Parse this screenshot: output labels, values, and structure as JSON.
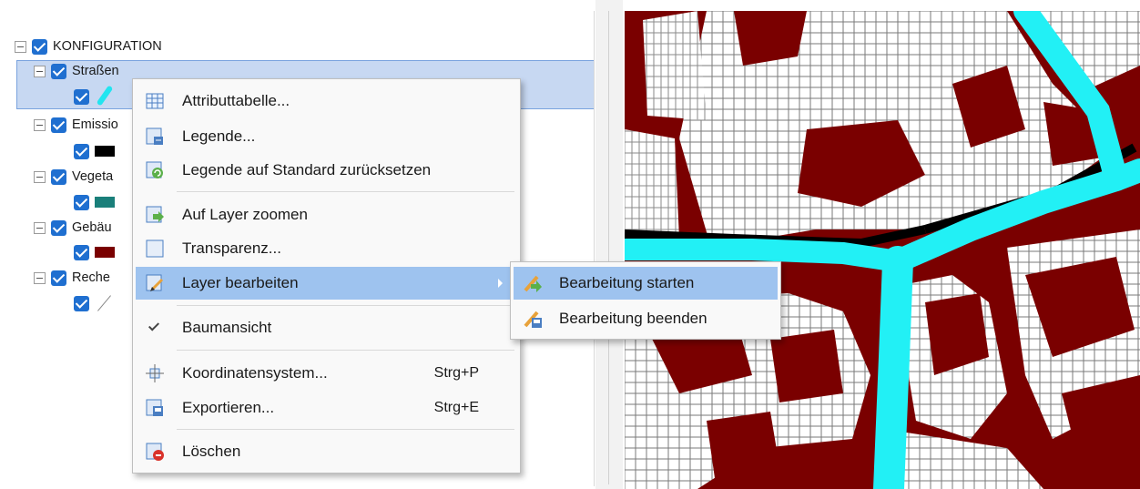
{
  "tree": {
    "root_label": "KONFIGURATION",
    "layers": [
      {
        "label": "Straßen",
        "swatch_icon": "pen-icon",
        "swatch_color": "#22e5f0"
      },
      {
        "label": "Emissio",
        "swatch_color": "#000000"
      },
      {
        "label": "Vegeta",
        "swatch_color": "#1a7f7a"
      },
      {
        "label": "Gebäu",
        "swatch_color": "#7a0000"
      },
      {
        "label": "Reche",
        "swatch_icon": "line-icon",
        "swatch_color": "#888888"
      }
    ]
  },
  "context_menu": {
    "items": [
      {
        "label": "Attributtabelle...",
        "icon": "table-icon"
      },
      {
        "label": "Legende...",
        "icon": "legend-icon"
      },
      {
        "label": "Legende auf Standard zurücksetzen",
        "icon": "reset-legend-icon"
      },
      {
        "label": "Auf Layer zoomen",
        "icon": "zoom-layer-icon"
      },
      {
        "label": "Transparenz...",
        "icon": "transparency-icon"
      },
      {
        "label": "Layer bearbeiten",
        "icon": "edit-layer-icon",
        "has_submenu": true,
        "active": true
      },
      {
        "label": "Baumansicht",
        "icon": "checkmark-icon",
        "checked": true
      },
      {
        "label": "Koordinatensystem...",
        "icon": "coordinate-system-icon",
        "shortcut": "Strg+P"
      },
      {
        "label": "Exportieren...",
        "icon": "export-icon",
        "shortcut": "Strg+E"
      },
      {
        "label": "Löschen",
        "icon": "delete-icon"
      }
    ]
  },
  "submenu": {
    "items": [
      {
        "label": "Bearbeitung starten",
        "icon": "start-edit-icon",
        "active": true
      },
      {
        "label": "Bearbeitung beenden",
        "icon": "stop-edit-icon"
      }
    ]
  },
  "colors": {
    "selection_bg": "#9ec3ef",
    "row_selection_bg": "#c7d8f2",
    "building_red": "#7a0000",
    "road_cyan": "#22f0f5",
    "checkbox_blue": "#1f6fd0"
  }
}
